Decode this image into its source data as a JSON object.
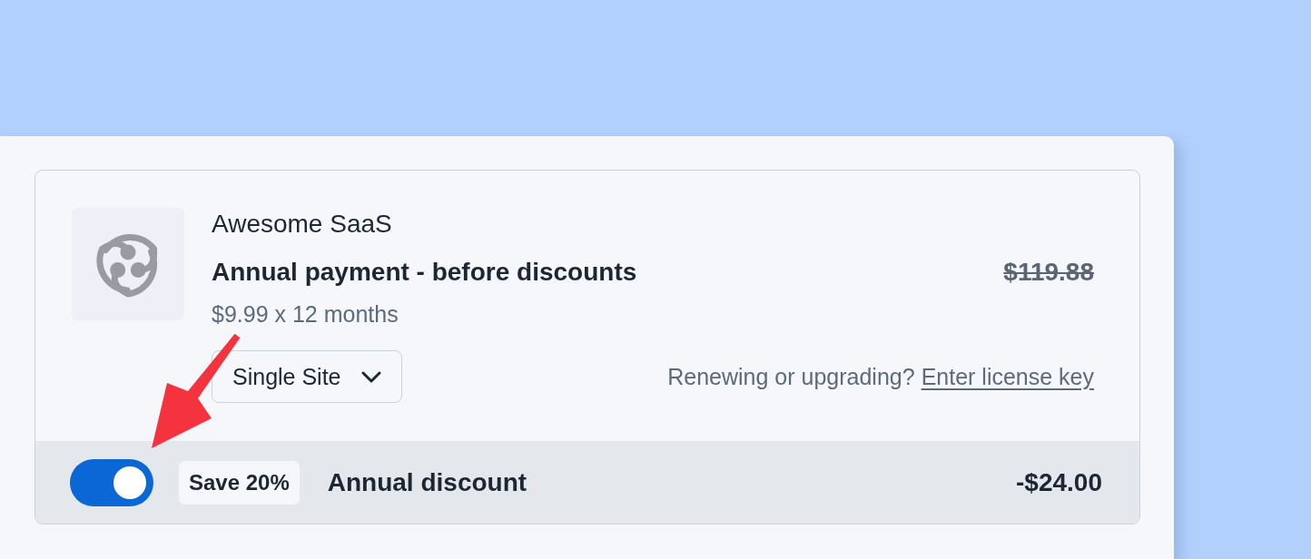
{
  "product": {
    "name": "Awesome SaaS",
    "title": "Annual payment - before discounts",
    "original_price": "$119.88",
    "original_price_struck": true,
    "price_breakdown": "$9.99 x 12 months"
  },
  "plan_select": {
    "value": "Single Site"
  },
  "license": {
    "prompt": "Renewing or upgrading?",
    "link": "Enter license key"
  },
  "discount": {
    "on": true,
    "badge": "Save 20%",
    "label": "Annual discount",
    "amount": "-$24.00"
  }
}
